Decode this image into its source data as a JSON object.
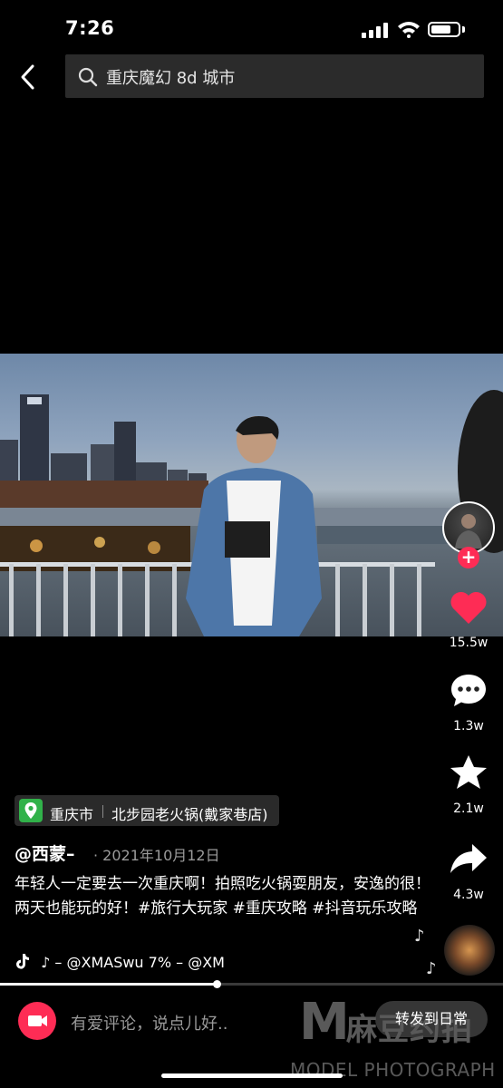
{
  "status_bar": {
    "time": "7:26",
    "battery_level": 0.65
  },
  "search": {
    "query": "重庆魔幻 8d 城市"
  },
  "video": {
    "progress": 0.43
  },
  "rail": {
    "likes": "15.5w",
    "comments": "1.3w",
    "favorites": "2.1w",
    "shares": "4.3w"
  },
  "location": {
    "city": "重庆市",
    "place": "北步园老火锅(戴家巷店)"
  },
  "post": {
    "author": "@西蒙–",
    "date": "· 2021年10月12日",
    "description": "年轻人一定要去一次重庆啊！拍照吃火锅耍朋友，安逸的很！两天也能玩的好！#旅行大玩家 #重庆攻略 #抖音玩乐攻略",
    "music": "♪ – @XMASwu   7% – @XM"
  },
  "comment_bar": {
    "placeholder": "有爱评论，说点儿好..",
    "forward_label": "转发到日常"
  },
  "watermark": {
    "mark": "M",
    "cn": "麻豆约拍",
    "en": "MODEL PHOTOGRAPH"
  },
  "colors": {
    "accent": "#fe2c55",
    "location_pin": "#31b24a"
  }
}
